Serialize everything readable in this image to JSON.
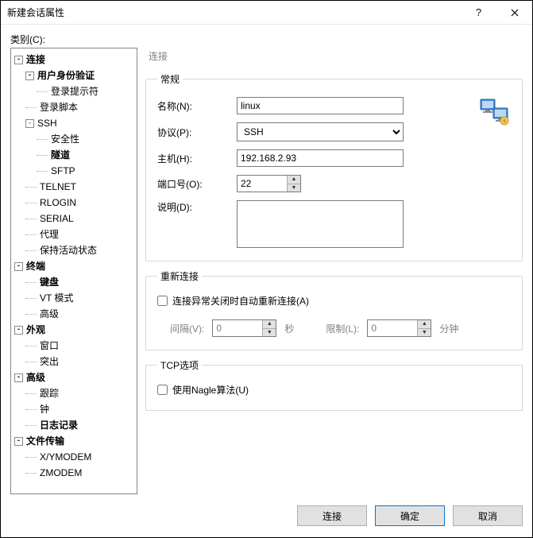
{
  "window": {
    "title": "新建会话属性"
  },
  "category_label": "类别(C):",
  "tree": {
    "connection": "连接",
    "auth": "用户身份验证",
    "login_prompt": "登录提示符",
    "login_script": "登录脚本",
    "ssh": "SSH",
    "security": "安全性",
    "tunnel": "隧道",
    "sftp": "SFTP",
    "telnet": "TELNET",
    "rlogin": "RLOGIN",
    "serial": "SERIAL",
    "proxy": "代理",
    "keepalive": "保持活动状态",
    "terminal": "终端",
    "keyboard": "键盘",
    "vt": "VT 模式",
    "advanced_term": "高级",
    "appearance": "外观",
    "window": "窗口",
    "highlight": "突出",
    "advanced": "高级",
    "trace": "跟踪",
    "bell": "钟",
    "logging": "日志记录",
    "file_transfer": "文件传输",
    "xymodem": "X/YMODEM",
    "zmodem": "ZMODEM"
  },
  "panel_title": "连接",
  "general": {
    "legend": "常规",
    "name_label": "名称(N):",
    "name_value": "linux",
    "protocol_label": "协议(P):",
    "protocol_value": "SSH",
    "host_label": "主机(H):",
    "host_value": "192.168.2.93",
    "port_label": "端口号(O):",
    "port_value": "22",
    "desc_label": "说明(D):",
    "desc_value": ""
  },
  "reconnect": {
    "legend": "重新连接",
    "auto_label": "连接异常关闭时自动重新连接(A)",
    "interval_label": "间隔(V):",
    "interval_value": "0",
    "interval_unit": "秒",
    "limit_label": "限制(L):",
    "limit_value": "0",
    "limit_unit": "分钟"
  },
  "tcp": {
    "legend": "TCP选项",
    "nagle_label": "使用Nagle算法(U)"
  },
  "buttons": {
    "connect": "连接",
    "ok": "确定",
    "cancel": "取消"
  }
}
